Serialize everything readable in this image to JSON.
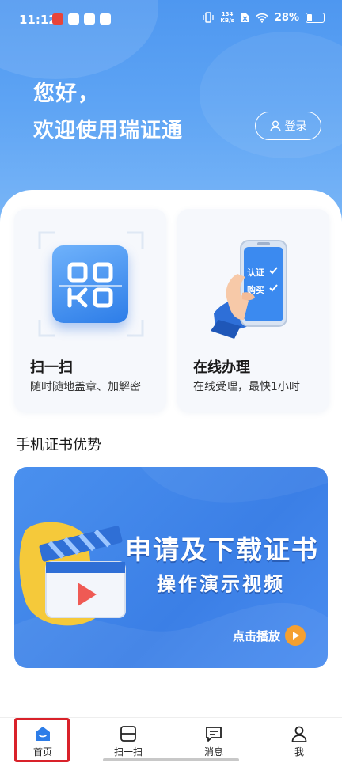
{
  "status_bar": {
    "time": "11:12",
    "net_speed_value": "134",
    "net_speed_unit": "KB/s",
    "battery": "28%"
  },
  "header": {
    "greeting": "您好，",
    "welcome": "欢迎使用瑞证通",
    "login_label": "登录"
  },
  "cards": [
    {
      "title": "扫一扫",
      "subtitle": "随时随地盖章、加解密"
    },
    {
      "title": "在线办理",
      "subtitle": "在线受理，最快1小时",
      "phone_line1": "认证",
      "phone_line2": "购买"
    }
  ],
  "section": {
    "title": "手机证书优势"
  },
  "banner": {
    "line1": "申请及下载证书",
    "line2": "操作演示视频",
    "play_label": "点击播放"
  },
  "tabbar": {
    "items": [
      {
        "label": "首页",
        "icon": "home-icon",
        "active": true
      },
      {
        "label": "扫一扫",
        "icon": "scan-icon"
      },
      {
        "label": "消息",
        "icon": "message-icon"
      },
      {
        "label": "我",
        "icon": "profile-icon"
      }
    ],
    "active_color": "#2d7de8",
    "highlight_color": "#d9222a"
  }
}
